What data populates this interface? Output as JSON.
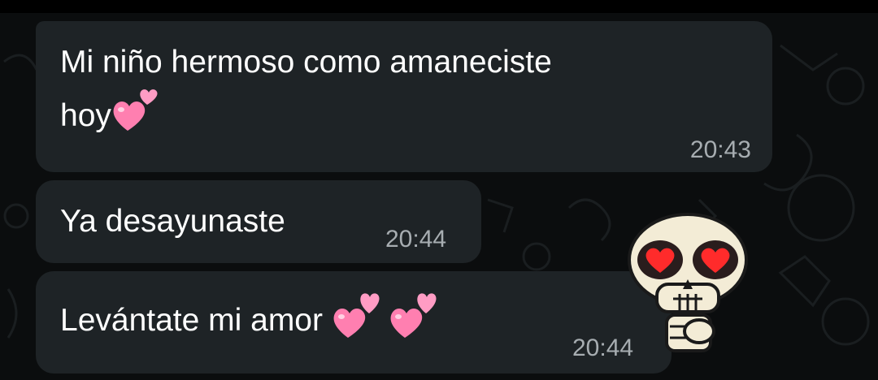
{
  "messages": [
    {
      "line1": "Mi niño hermoso como amaneciste",
      "line2": "hoy",
      "emoji": "two-hearts",
      "time": "20:43"
    },
    {
      "text": "Ya desayunaste",
      "time": "20:44"
    },
    {
      "text": "Levántate mi amor",
      "emoji": "two-hearts x2",
      "time": "20:44"
    }
  ],
  "sticker": {
    "name": "skull-heart-eyes-sticker"
  },
  "colors": {
    "background": "#0b0d0e",
    "bubble": "#1e2326",
    "text": "#ffffff",
    "timestamp": "#a7adb1",
    "heart": "#ff7fb0"
  }
}
